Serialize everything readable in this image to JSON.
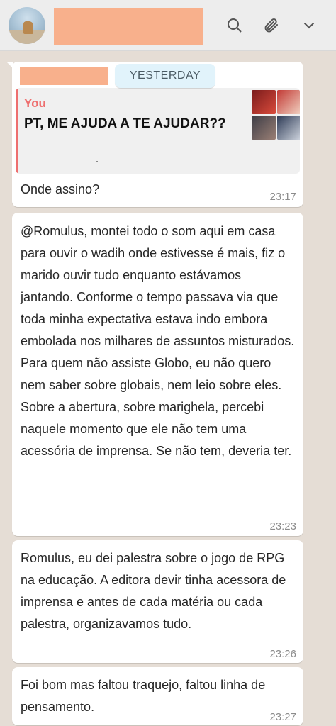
{
  "header": {
    "contact_name": "",
    "icons": [
      "search-icon",
      "paperclip-icon",
      "chevron-down-icon"
    ]
  },
  "chat": {
    "date_divider": "YESTERDAY",
    "messages": [
      {
        "sender": "",
        "quote_author": "You",
        "quote_text": "PT, ME AJUDA A TE AJUDAR??",
        "text": "Onde assino?",
        "time": "23:17"
      },
      {
        "text": "@Romulus, montei todo o som aqui em casa para ouvir o wadih onde estivesse é mais, fiz o marido ouvir tudo enquanto estávamos jantando. Conforme o tempo passava via que toda minha expectativa estava indo embora embolada nos milhares de assuntos misturados. Para quem não assiste Globo, eu não quero nem saber sobre globais, nem leio sobre eles. Sobre a abertura, sobre marighela, percebi naquele momento que ele não tem uma acessória de imprensa. Se não tem, deveria ter.",
        "time": "23:23"
      },
      {
        "text": "Romulus, eu dei palestra sobre o jogo de RPG na educação. A editora devir tinha acessora de imprensa e antes de cada matéria ou cada palestra, organizavamos tudo.",
        "time": "23:26"
      },
      {
        "text": "Foi bom mas faltou traquejo, faltou linha de pensamento.",
        "time": "23:27"
      }
    ]
  },
  "colors": {
    "chat_background": "#e5ddd5",
    "bubble": "#ffffff",
    "quote_accent": "#ee6f6f",
    "date_chip": "#e1f3fb",
    "redaction": "#f8b08c"
  }
}
